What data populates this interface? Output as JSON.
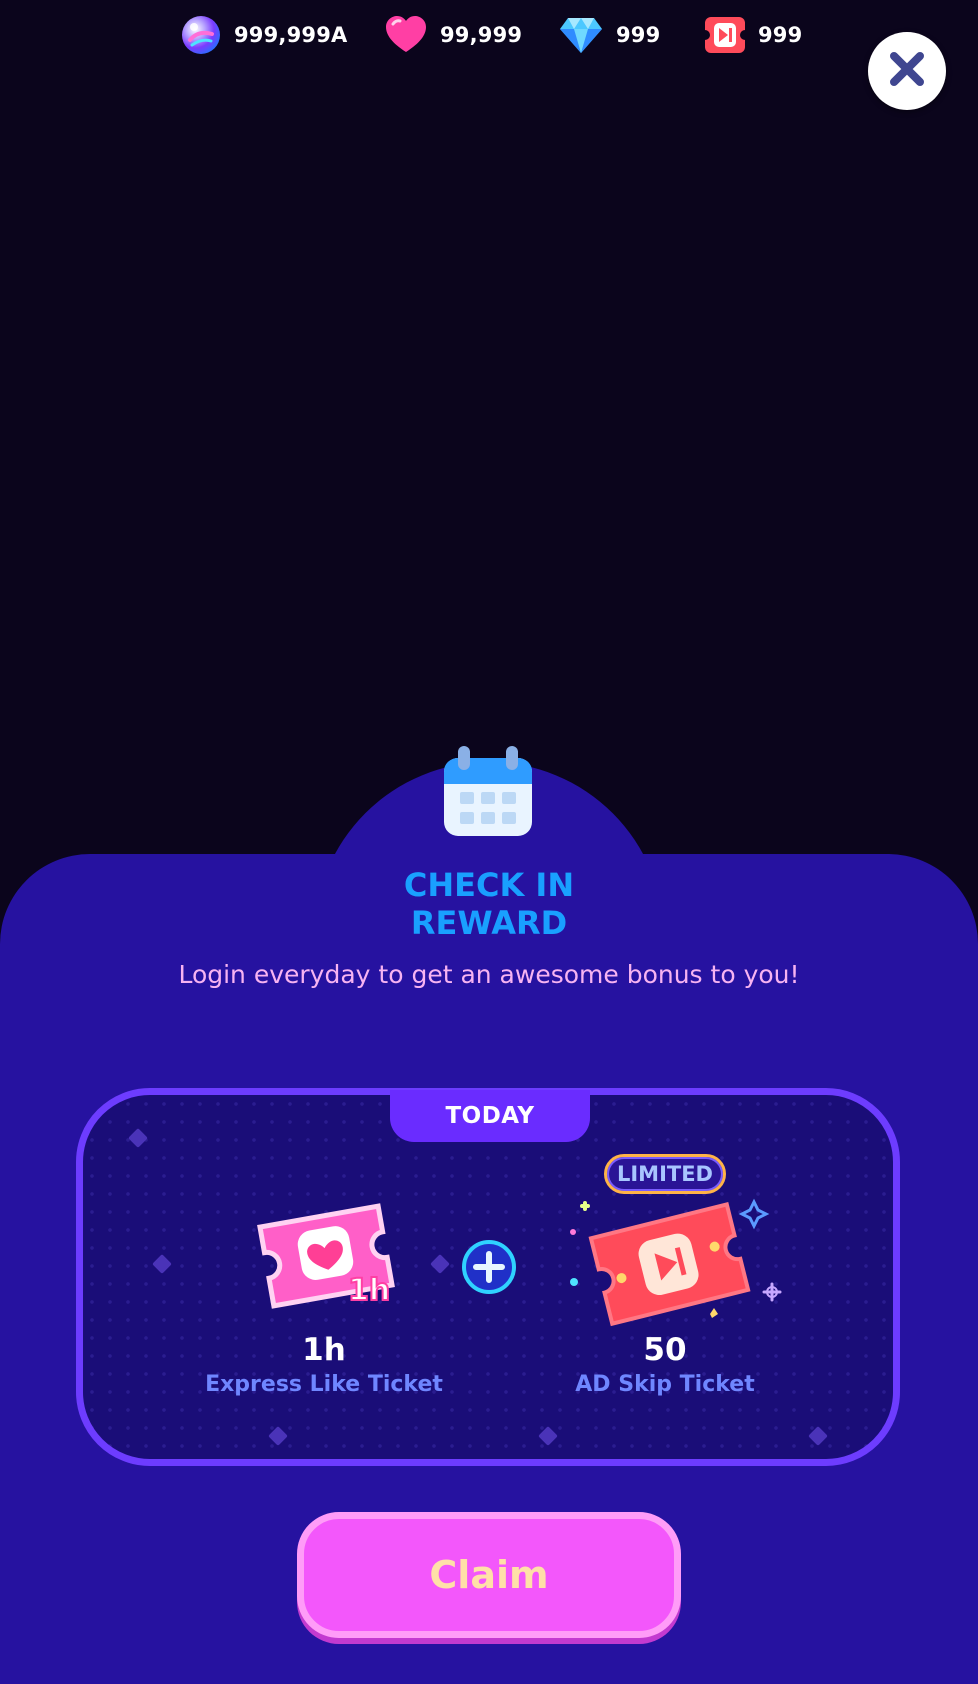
{
  "currencies": [
    {
      "name": "orb",
      "value": "999,999A",
      "icon": "orb-icon"
    },
    {
      "name": "hearts",
      "value": "99,999",
      "icon": "heart-icon"
    },
    {
      "name": "gems",
      "value": "999",
      "icon": "diamond-icon"
    },
    {
      "name": "ad_skip",
      "value": "999",
      "icon": "ad-skip-icon"
    }
  ],
  "close_icon": "close-icon",
  "title_line1": "CHECK IN",
  "title_line2": "REWARD",
  "subtitle": "Login everyday to get an awesome bonus to you!",
  "today_label": "TODAY",
  "limited_label": "LIMITED",
  "rewards": [
    {
      "amount": "1h",
      "name": "Express Like Ticket",
      "badge": "1h",
      "icon": "express-like-ticket-icon"
    },
    {
      "amount": "50",
      "name": "AD Skip Ticket",
      "icon": "ad-skip-ticket-icon"
    }
  ],
  "claim_label": "Claim",
  "colors": {
    "background": "#0b051c",
    "sheet": "#2612a0",
    "title": "#19a0ff",
    "subtitle": "#f7b3f2",
    "card_border": "#6d3cff",
    "claim": "#f357fb",
    "claim_text": "#ffe0a8",
    "reward_name": "#6f86ff"
  }
}
